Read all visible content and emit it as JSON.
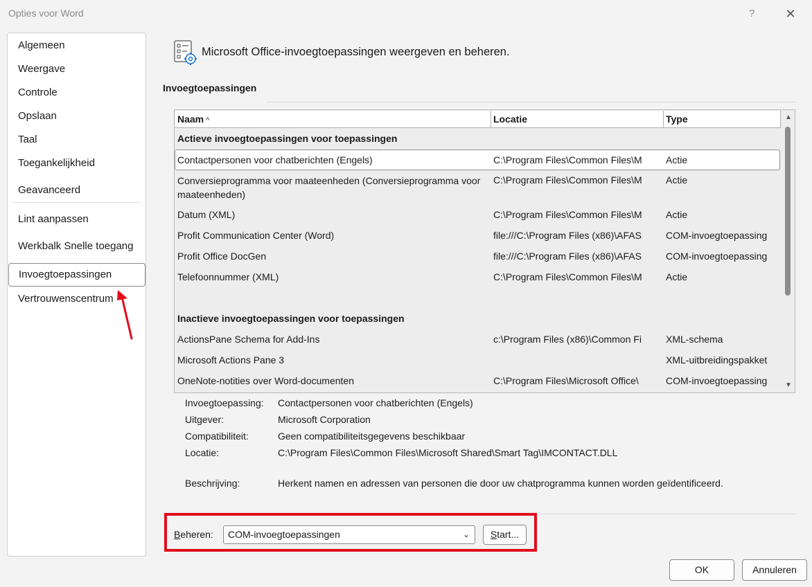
{
  "window": {
    "title": "Opties voor Word",
    "help_glyph": "?",
    "close_glyph": "✕"
  },
  "sidebar": {
    "items": [
      {
        "label": "Algemeen"
      },
      {
        "label": "Weergave"
      },
      {
        "label": "Controle"
      },
      {
        "label": "Opslaan"
      },
      {
        "label": "Taal"
      },
      {
        "label": "Toegankelijkheid"
      },
      {
        "label": "Geavanceerd"
      },
      {
        "label": "Lint aanpassen"
      },
      {
        "label": "Werkbalk Snelle toegang"
      },
      {
        "label": "Invoegtoepassingen",
        "selected": true
      },
      {
        "label": "Vertrouwenscentrum"
      }
    ]
  },
  "annotation": {
    "arrow_color": "#e00d1d"
  },
  "header": {
    "icon": "addin-list-gear-icon",
    "text": "Microsoft Office-invoegtoepassingen weergeven en beheren."
  },
  "section": {
    "title": "Invoegtoepassingen"
  },
  "table": {
    "columns": [
      {
        "label": "Naam",
        "sort": "^"
      },
      {
        "label": "Locatie"
      },
      {
        "label": "Type"
      }
    ],
    "active_group": "Actieve invoegtoepassingen voor toepassingen",
    "active_rows": [
      {
        "name": "Contactpersonen voor chatberichten (Engels)",
        "location": "C:\\Program Files\\Common Files\\M",
        "type": "Actie",
        "selected": true
      },
      {
        "name": "Conversieprogramma voor maateenheden (Conversieprogramma voor maateenheden)",
        "location": "C:\\Program Files\\Common Files\\M",
        "type": "Actie"
      },
      {
        "name": "Datum (XML)",
        "location": "C:\\Program Files\\Common Files\\M",
        "type": "Actie"
      },
      {
        "name": "Profit Communication Center (Word)",
        "location": "file:///C:\\Program Files (x86)\\AFAS",
        "type": "COM-invoegtoepassing"
      },
      {
        "name": "Profit Office DocGen",
        "location": "file:///C:\\Program Files (x86)\\AFAS",
        "type": "COM-invoegtoepassing"
      },
      {
        "name": "Telefoonnummer (XML)",
        "location": "C:\\Program Files\\Common Files\\M",
        "type": "Actie"
      }
    ],
    "inactive_group": "Inactieve invoegtoepassingen voor toepassingen",
    "inactive_rows": [
      {
        "name": "ActionsPane Schema for Add-Ins",
        "location": "c:\\Program Files (x86)\\Common Fi",
        "type": "XML-schema"
      },
      {
        "name": "Microsoft Actions Pane 3",
        "location": "",
        "type": "XML-uitbreidingspakket"
      },
      {
        "name": "OneNote-notities over Word-documenten",
        "location": "C:\\Program Files\\Microsoft Office\\",
        "type": "COM-invoegtoepassing"
      }
    ]
  },
  "details": {
    "addin_label": "Invoegtoepassing:",
    "addin_value": "Contactpersonen voor chatberichten (Engels)",
    "publisher_label": "Uitgever:",
    "publisher_value": "Microsoft Corporation",
    "compat_label": "Compatibiliteit:",
    "compat_value": "Geen compatibiliteitsgegevens beschikbaar",
    "location_label": "Locatie:",
    "location_value": "C:\\Program Files\\Common Files\\Microsoft Shared\\Smart Tag\\IMCONTACT.DLL",
    "description_label": "Beschrijving:",
    "description_value": "Herkent namen en adressen van personen die door uw chatprogramma kunnen worden geïdentificeerd."
  },
  "manage": {
    "label_mnemonic": "B",
    "label_rest": "eheren:",
    "selected": "COM-invoegtoepassingen",
    "start_mnemonic": "S",
    "start_rest": "tart...",
    "highlight_color": "#e00d1d"
  },
  "footer": {
    "ok": "OK",
    "cancel": "Annuleren"
  }
}
